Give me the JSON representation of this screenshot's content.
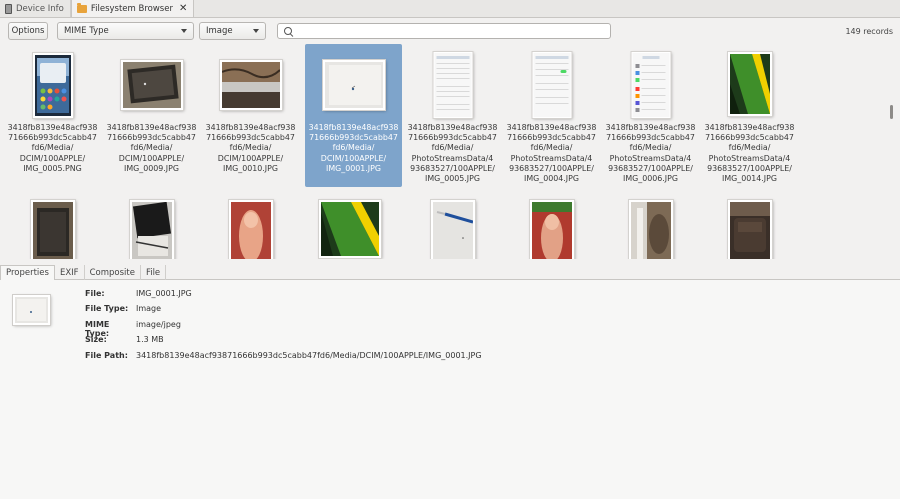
{
  "top_tabs": [
    {
      "label": "Device Info",
      "icon": "device-icon",
      "active": false
    },
    {
      "label": "Filesystem Browser",
      "icon": "folder-icon",
      "active": true
    }
  ],
  "toolbar": {
    "options_label": "Options",
    "mime_filter": "MIME Type",
    "type_filter": "Image",
    "search_value": "",
    "record_count": "149 records"
  },
  "tiles": [
    {
      "caption": "3418fb8139e48acf938\n71666b993dc5cabb47\nfd6/Media/\nDCIM/100APPLE/\nIMG_0005.PNG",
      "thumb": "iphone-lockscreen",
      "selected": false
    },
    {
      "caption": "3418fb8139e48acf938\n71666b993dc5cabb47\nfd6/Media/\nDCIM/100APPLE/\nIMG_0009.JPG",
      "thumb": "tablet-photo",
      "selected": false
    },
    {
      "caption": "3418fb8139e48acf938\n71666b993dc5cabb47\nfd6/Media/\nDCIM/100APPLE/\nIMG_0010.JPG",
      "thumb": "fur-photo",
      "selected": false
    },
    {
      "caption": "3418fb8139e48acf938\n71666b993dc5cabb47\nfd6/Media/\nDCIM/100APPLE/\nIMG_0001.JPG",
      "thumb": "paper-dot",
      "selected": true
    },
    {
      "caption": "3418fb8139e48acf938\n71666b993dc5cabb47\nfd6/Media/\nPhotoStreamsData/4\n93683527/100APPLE/\nIMG_0005.JPG",
      "thumb": "settings-screen",
      "selected": false
    },
    {
      "caption": "3418fb8139e48acf938\n71666b993dc5cabb47\nfd6/Media/\nPhotoStreamsData/4\n93683527/100APPLE/\nIMG_0004.JPG",
      "thumb": "settings-screen",
      "selected": false
    },
    {
      "caption": "3418fb8139e48acf938\n71666b993dc5cabb47\nfd6/Media/\nPhotoStreamsData/4\n93683527/100APPLE/\nIMG_0006.JPG",
      "thumb": "settings-menu",
      "selected": false
    },
    {
      "caption": "3418fb8139e48acf938\n71666b993dc5cabb47\nfd6/Media/\nPhotoStreamsData/4\n93683527/100APPLE/\nIMG_0014.JPG",
      "thumb": "green-book",
      "selected": false
    },
    {
      "caption": "",
      "thumb": "dark-tablet",
      "selected": false
    },
    {
      "caption": "",
      "thumb": "black-phone",
      "selected": false
    },
    {
      "caption": "",
      "thumb": "thumb-finger",
      "selected": false
    },
    {
      "caption": "",
      "thumb": "green-book-2",
      "selected": false
    },
    {
      "caption": "",
      "thumb": "pen-paper",
      "selected": false
    },
    {
      "caption": "",
      "thumb": "thumb-red",
      "selected": false
    },
    {
      "caption": "",
      "thumb": "cat-photo",
      "selected": false
    },
    {
      "caption": "",
      "thumb": "leather-chair",
      "selected": false
    }
  ],
  "bottom_tabs": [
    {
      "label": "Properties",
      "active": true
    },
    {
      "label": "EXIF",
      "active": false
    },
    {
      "label": "Composite",
      "active": false
    },
    {
      "label": "File",
      "active": false
    }
  ],
  "properties": {
    "file_label": "File:",
    "file": "IMG_0001.JPG",
    "file_type_label": "File Type:",
    "file_type": "Image",
    "mime_label": "MIME Type:",
    "mime": "image/jpeg",
    "size_label": "Size:",
    "size": "1.3 MB",
    "path_label": "File Path:",
    "path": "3418fb8139e48acf93871666b993dc5cabb47fd6/Media/DCIM/100APPLE/IMG_0001.JPG"
  },
  "colors": {
    "selection": "#7ea4cb",
    "window_bg": "#f2f1f0"
  }
}
